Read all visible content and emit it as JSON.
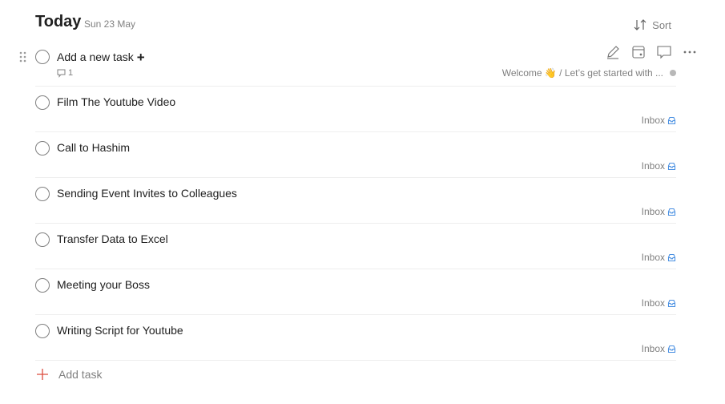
{
  "header": {
    "title": "Today",
    "date": "Sun 23 May",
    "sort_label": "Sort"
  },
  "first_task": {
    "content": "Add a new task",
    "comment_count": "1",
    "section_path": "Welcome 👋 / Let’s get started with ..."
  },
  "tasks": [
    {
      "content": "Film The Youtube Video",
      "project": "Inbox"
    },
    {
      "content": "Call to Hashim",
      "project": "Inbox"
    },
    {
      "content": "Sending Event Invites to Colleagues",
      "project": "Inbox"
    },
    {
      "content": "Transfer Data to Excel",
      "project": "Inbox"
    },
    {
      "content": "Meeting your Boss",
      "project": "Inbox"
    },
    {
      "content": "Writing Script for Youtube",
      "project": "Inbox"
    }
  ],
  "add_task_label": "Add task",
  "colors": {
    "accent_red": "#dc4c3e",
    "inbox_blue": "#4a90e2",
    "muted_text": "#808080"
  }
}
